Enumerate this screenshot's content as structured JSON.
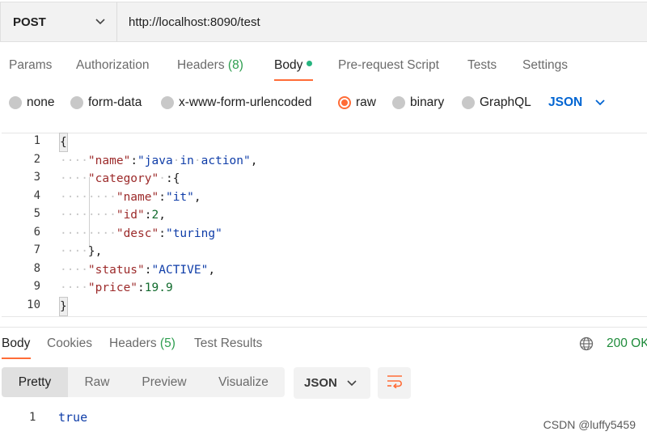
{
  "request": {
    "method": "POST",
    "url": "http://localhost:8090/test"
  },
  "request_tabs": [
    {
      "label": "Params"
    },
    {
      "label": "Authorization"
    },
    {
      "label": "Headers",
      "count": "(8)"
    },
    {
      "label": "Body"
    },
    {
      "label": "Pre-request Script"
    },
    {
      "label": "Tests"
    },
    {
      "label": "Settings"
    }
  ],
  "body_types": [
    {
      "label": "none"
    },
    {
      "label": "form-data"
    },
    {
      "label": "x-www-form-urlencoded"
    },
    {
      "label": "raw"
    },
    {
      "label": "binary"
    },
    {
      "label": "GraphQL"
    }
  ],
  "body_language": "JSON",
  "editor": {
    "line_numbers": [
      "1",
      "2",
      "3",
      "4",
      "5",
      "6",
      "7",
      "8",
      "9",
      "10"
    ],
    "lines": [
      {
        "indent": "",
        "tokens": [
          {
            "t": "p",
            "v": "{"
          }
        ]
      },
      {
        "indent": "····",
        "tokens": [
          {
            "t": "k",
            "v": "\"name\""
          },
          {
            "t": "p",
            "v": ":"
          },
          {
            "t": "s",
            "v": "\"java"
          },
          {
            "t": "ws",
            "v": "·"
          },
          {
            "t": "s",
            "v": "in"
          },
          {
            "t": "ws",
            "v": "·"
          },
          {
            "t": "s",
            "v": "action\""
          },
          {
            "t": "p",
            "v": ","
          }
        ]
      },
      {
        "indent": "····",
        "tokens": [
          {
            "t": "k",
            "v": "\"category\""
          },
          {
            "t": "ws",
            "v": "·"
          },
          {
            "t": "p",
            "v": ":{"
          }
        ]
      },
      {
        "indent": "········",
        "tokens": [
          {
            "t": "k",
            "v": "\"name\""
          },
          {
            "t": "p",
            "v": ":"
          },
          {
            "t": "s",
            "v": "\"it\""
          },
          {
            "t": "p",
            "v": ","
          }
        ]
      },
      {
        "indent": "········",
        "tokens": [
          {
            "t": "k",
            "v": "\"id\""
          },
          {
            "t": "p",
            "v": ":"
          },
          {
            "t": "n",
            "v": "2"
          },
          {
            "t": "p",
            "v": ","
          }
        ]
      },
      {
        "indent": "········",
        "tokens": [
          {
            "t": "k",
            "v": "\"desc\""
          },
          {
            "t": "p",
            "v": ":"
          },
          {
            "t": "s",
            "v": "\"turing\""
          }
        ]
      },
      {
        "indent": "····",
        "tokens": [
          {
            "t": "p",
            "v": "},"
          }
        ]
      },
      {
        "indent": "····",
        "tokens": [
          {
            "t": "k",
            "v": "\"status\""
          },
          {
            "t": "p",
            "v": ":"
          },
          {
            "t": "s",
            "v": "\"ACTIVE\""
          },
          {
            "t": "p",
            "v": ","
          }
        ]
      },
      {
        "indent": "····",
        "tokens": [
          {
            "t": "k",
            "v": "\"price\""
          },
          {
            "t": "p",
            "v": ":"
          },
          {
            "t": "n",
            "v": "19.9"
          }
        ]
      },
      {
        "indent": "",
        "tokens": [
          {
            "t": "p",
            "v": "}"
          }
        ]
      }
    ]
  },
  "response_tabs": [
    {
      "label": "Body"
    },
    {
      "label": "Cookies"
    },
    {
      "label": "Headers",
      "count": "(5)"
    },
    {
      "label": "Test Results"
    }
  ],
  "response_status": "200 OK",
  "view_modes": [
    "Pretty",
    "Raw",
    "Preview",
    "Visualize"
  ],
  "response_format": "JSON",
  "response_body": {
    "line_number": "1",
    "value": "true"
  },
  "watermark": "CSDN @luffy5459",
  "colors": {
    "accent": "#ff6c37",
    "link_blue": "#0265d2",
    "status_green": "#1e8b3a"
  }
}
